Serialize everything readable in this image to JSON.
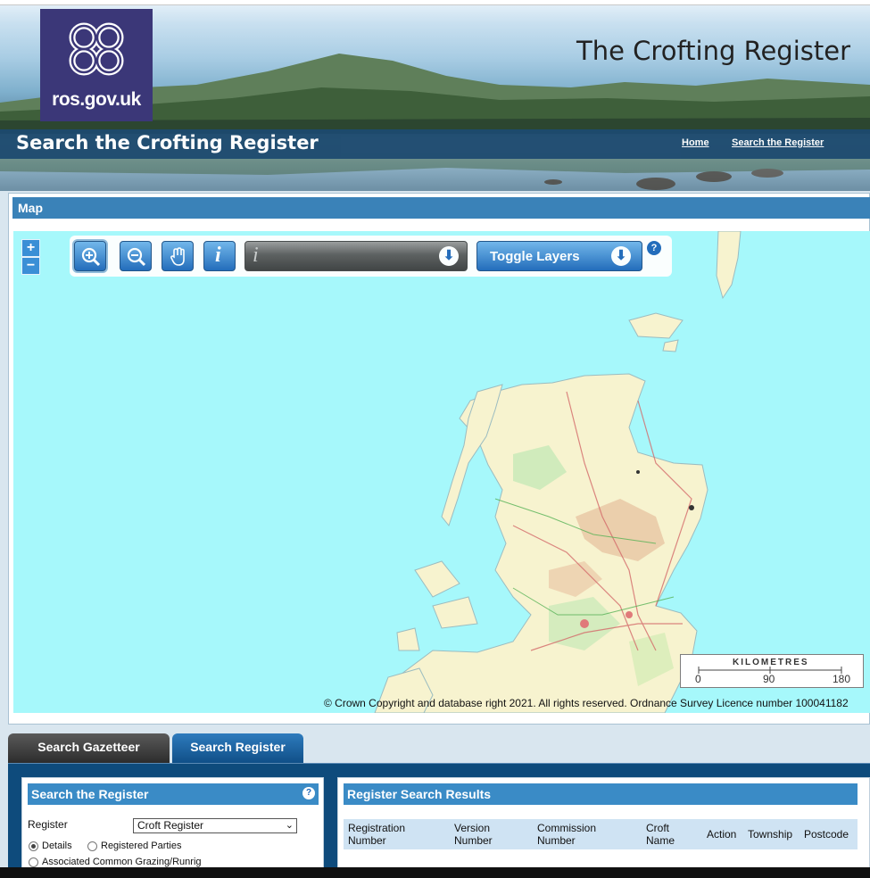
{
  "header": {
    "logo_text": "ros.gov.uk",
    "site_title": "The Crofting Register",
    "page_title": "Search the Crofting Register",
    "nav": [
      {
        "label": "Home"
      },
      {
        "label": "Search the Register"
      }
    ]
  },
  "map_panel": {
    "title": "Map",
    "zoom_in": "+",
    "zoom_out": "−",
    "toggle_layers_label": "Toggle Layers",
    "info_glyph": "i",
    "help_glyph": "?",
    "scale": {
      "title": "KILOMETRES",
      "ticks": [
        "0",
        "90",
        "180"
      ]
    },
    "copyright": "© Crown Copyright and database right 2021. All rights reserved. Ordnance Survey Licence number 100041182"
  },
  "tabs": [
    {
      "label": "Search Gazetteer",
      "active": false
    },
    {
      "label": "Search Register",
      "active": true
    }
  ],
  "search_form": {
    "title": "Search the Register",
    "help_glyph": "?",
    "register_label": "Register",
    "register_value": "Croft Register",
    "options": [
      {
        "label": "Details",
        "checked": true
      },
      {
        "label": "Registered Parties",
        "checked": false
      },
      {
        "label": "Associated Common Grazing/Runrig",
        "checked": false
      }
    ]
  },
  "results": {
    "title": "Register Search Results",
    "columns": [
      {
        "l1": "Registration",
        "l2": "Number"
      },
      {
        "l1": "Version",
        "l2": "Number"
      },
      {
        "l1": "Commission",
        "l2": "Number"
      },
      {
        "l1": "Croft",
        "l2": "Name"
      },
      {
        "l1": "Action",
        "l2": ""
      },
      {
        "l1": "Township",
        "l2": ""
      },
      {
        "l1": "Postcode",
        "l2": ""
      }
    ]
  },
  "colors": {
    "header_bar": "#1d4a6e",
    "accent_blue": "#3a82b8",
    "map_sea": "#a6f8fb",
    "logo_bg": "#3b3778"
  },
  "icons": [
    "zoom-in-icon",
    "zoom-out-icon",
    "pan-hand-icon",
    "info-icon",
    "arrow-down-circle-icon",
    "help-icon"
  ]
}
